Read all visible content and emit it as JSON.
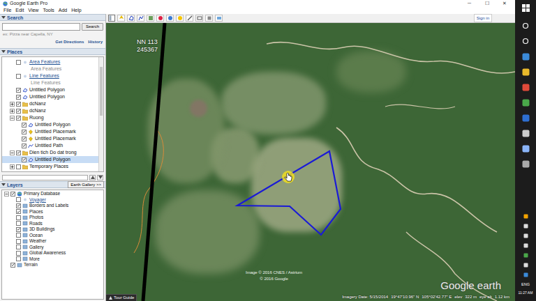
{
  "window": {
    "title": "Google Earth Pro",
    "controls": [
      "─",
      "☐",
      "✕"
    ]
  },
  "menu": [
    "File",
    "Edit",
    "View",
    "Tools",
    "Add",
    "Help"
  ],
  "toolbar": {
    "sign_in": "Sign in"
  },
  "search": {
    "header": "Search",
    "button": "Search",
    "hint": "ex: Pizza near Capella, NY",
    "links": [
      "Get Directions",
      "History"
    ]
  },
  "places": {
    "header": "Places",
    "items": [
      {
        "label": "Area Features",
        "kind": "link",
        "note": "Area Features",
        "checked": false,
        "selected": false
      },
      {
        "label": "Line Features",
        "kind": "link",
        "note": "Line Features",
        "checked": false,
        "selected": false
      },
      {
        "label": "Untitled Polygon",
        "kind": "polygon",
        "checked": true,
        "selected": false
      },
      {
        "label": "Untitled Polygon",
        "kind": "polygon",
        "checked": true,
        "selected": false
      },
      {
        "label": "dcNanz",
        "kind": "folder",
        "checked": true,
        "expanded": false,
        "selected": false
      },
      {
        "label": "dcNanz",
        "kind": "folder",
        "checked": true,
        "expanded": false,
        "selected": false
      },
      {
        "label": "Ruong",
        "kind": "folder",
        "checked": true,
        "expanded": true,
        "selected": false,
        "children": [
          {
            "label": "Untitled Polygon",
            "kind": "polygon",
            "checked": true,
            "selected": false
          },
          {
            "label": "Untitled Placemark",
            "kind": "placemark",
            "checked": true,
            "selected": false
          },
          {
            "label": "Untitled Placemark",
            "kind": "placemark",
            "checked": true,
            "selected": false
          },
          {
            "label": "Untitled Path",
            "kind": "path",
            "checked": true,
            "selected": false
          }
        ]
      },
      {
        "label": "Dien tich Do dat trong",
        "kind": "folder",
        "checked": true,
        "expanded": true,
        "selected": false,
        "children": [
          {
            "label": "Untitled Polygon",
            "kind": "polygon",
            "checked": true,
            "selected": true
          }
        ]
      },
      {
        "label": "Temporary Places",
        "kind": "folder",
        "checked": false,
        "expanded": false,
        "selected": false
      }
    ]
  },
  "layers": {
    "header": "Layers",
    "gallery_button": "Earth Gallery >>",
    "items": [
      {
        "label": "Primary Database",
        "kind": "database",
        "checked": true,
        "expanded": true,
        "selected": false,
        "children": [
          {
            "label": "Voyager",
            "kind": "link",
            "checked": false,
            "selected": false
          },
          {
            "label": "Borders and Labels",
            "kind": "layer",
            "checked": true,
            "selected": false
          },
          {
            "label": "Places",
            "kind": "layer",
            "checked": true,
            "selected": false
          },
          {
            "label": "Photos",
            "kind": "layer",
            "checked": false,
            "selected": false
          },
          {
            "label": "Roads",
            "kind": "layer",
            "checked": false,
            "selected": false
          },
          {
            "label": "3D Buildings",
            "kind": "layer",
            "checked": true,
            "selected": false
          },
          {
            "label": "Ocean",
            "kind": "layer",
            "checked": false,
            "selected": false
          },
          {
            "label": "Weather",
            "kind": "layer",
            "checked": false,
            "selected": false
          },
          {
            "label": "Gallery",
            "kind": "layer",
            "checked": false,
            "selected": false
          },
          {
            "label": "Global Awareness",
            "kind": "layer",
            "checked": false,
            "selected": false
          },
          {
            "label": "More",
            "kind": "layer",
            "checked": false,
            "selected": false
          }
        ]
      },
      {
        "label": "Terrain",
        "kind": "layer",
        "checked": true,
        "selected": false
      }
    ]
  },
  "map": {
    "label": [
      "NN 113",
      "245367"
    ],
    "attribution": [
      "Image © 2016 CNES / Astrium",
      "© 2016 Google"
    ],
    "logo": "Google earth",
    "tour_guide": "Tour Guide",
    "status": [
      "Imagery Date: 5/15/2014",
      "19°47'10.96\" N",
      "105°02'42.77\" E",
      "elev",
      "322 m",
      "eye alt",
      "1.12 km"
    ]
  },
  "taskbar": {
    "time": "11:27 AM",
    "language": "ENG"
  }
}
